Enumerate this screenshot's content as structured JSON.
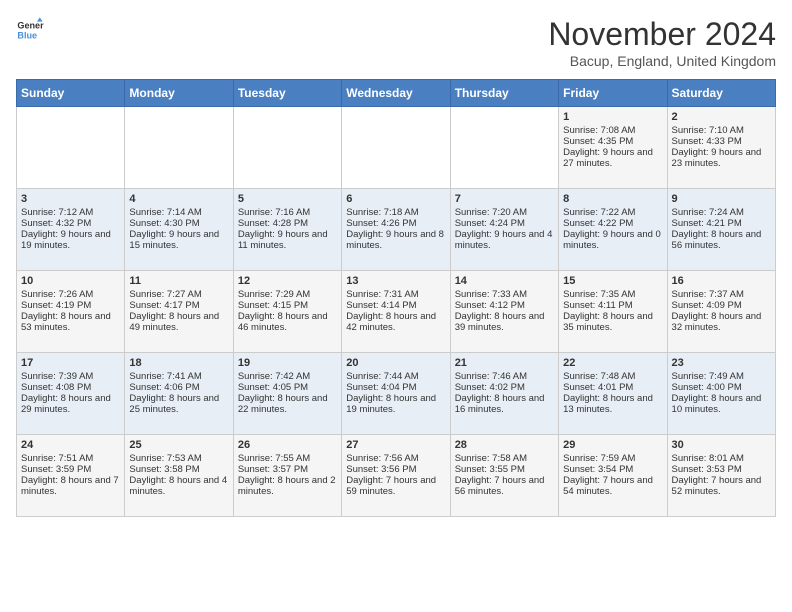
{
  "logo": {
    "line1": "General",
    "line2": "Blue"
  },
  "title": "November 2024",
  "subtitle": "Bacup, England, United Kingdom",
  "days_header": [
    "Sunday",
    "Monday",
    "Tuesday",
    "Wednesday",
    "Thursday",
    "Friday",
    "Saturday"
  ],
  "weeks": [
    [
      {
        "day": "",
        "info": ""
      },
      {
        "day": "",
        "info": ""
      },
      {
        "day": "",
        "info": ""
      },
      {
        "day": "",
        "info": ""
      },
      {
        "day": "",
        "info": ""
      },
      {
        "day": "1",
        "info": "Sunrise: 7:08 AM\nSunset: 4:35 PM\nDaylight: 9 hours and 27 minutes."
      },
      {
        "day": "2",
        "info": "Sunrise: 7:10 AM\nSunset: 4:33 PM\nDaylight: 9 hours and 23 minutes."
      }
    ],
    [
      {
        "day": "3",
        "info": "Sunrise: 7:12 AM\nSunset: 4:32 PM\nDaylight: 9 hours and 19 minutes."
      },
      {
        "day": "4",
        "info": "Sunrise: 7:14 AM\nSunset: 4:30 PM\nDaylight: 9 hours and 15 minutes."
      },
      {
        "day": "5",
        "info": "Sunrise: 7:16 AM\nSunset: 4:28 PM\nDaylight: 9 hours and 11 minutes."
      },
      {
        "day": "6",
        "info": "Sunrise: 7:18 AM\nSunset: 4:26 PM\nDaylight: 9 hours and 8 minutes."
      },
      {
        "day": "7",
        "info": "Sunrise: 7:20 AM\nSunset: 4:24 PM\nDaylight: 9 hours and 4 minutes."
      },
      {
        "day": "8",
        "info": "Sunrise: 7:22 AM\nSunset: 4:22 PM\nDaylight: 9 hours and 0 minutes."
      },
      {
        "day": "9",
        "info": "Sunrise: 7:24 AM\nSunset: 4:21 PM\nDaylight: 8 hours and 56 minutes."
      }
    ],
    [
      {
        "day": "10",
        "info": "Sunrise: 7:26 AM\nSunset: 4:19 PM\nDaylight: 8 hours and 53 minutes."
      },
      {
        "day": "11",
        "info": "Sunrise: 7:27 AM\nSunset: 4:17 PM\nDaylight: 8 hours and 49 minutes."
      },
      {
        "day": "12",
        "info": "Sunrise: 7:29 AM\nSunset: 4:15 PM\nDaylight: 8 hours and 46 minutes."
      },
      {
        "day": "13",
        "info": "Sunrise: 7:31 AM\nSunset: 4:14 PM\nDaylight: 8 hours and 42 minutes."
      },
      {
        "day": "14",
        "info": "Sunrise: 7:33 AM\nSunset: 4:12 PM\nDaylight: 8 hours and 39 minutes."
      },
      {
        "day": "15",
        "info": "Sunrise: 7:35 AM\nSunset: 4:11 PM\nDaylight: 8 hours and 35 minutes."
      },
      {
        "day": "16",
        "info": "Sunrise: 7:37 AM\nSunset: 4:09 PM\nDaylight: 8 hours and 32 minutes."
      }
    ],
    [
      {
        "day": "17",
        "info": "Sunrise: 7:39 AM\nSunset: 4:08 PM\nDaylight: 8 hours and 29 minutes."
      },
      {
        "day": "18",
        "info": "Sunrise: 7:41 AM\nSunset: 4:06 PM\nDaylight: 8 hours and 25 minutes."
      },
      {
        "day": "19",
        "info": "Sunrise: 7:42 AM\nSunset: 4:05 PM\nDaylight: 8 hours and 22 minutes."
      },
      {
        "day": "20",
        "info": "Sunrise: 7:44 AM\nSunset: 4:04 PM\nDaylight: 8 hours and 19 minutes."
      },
      {
        "day": "21",
        "info": "Sunrise: 7:46 AM\nSunset: 4:02 PM\nDaylight: 8 hours and 16 minutes."
      },
      {
        "day": "22",
        "info": "Sunrise: 7:48 AM\nSunset: 4:01 PM\nDaylight: 8 hours and 13 minutes."
      },
      {
        "day": "23",
        "info": "Sunrise: 7:49 AM\nSunset: 4:00 PM\nDaylight: 8 hours and 10 minutes."
      }
    ],
    [
      {
        "day": "24",
        "info": "Sunrise: 7:51 AM\nSunset: 3:59 PM\nDaylight: 8 hours and 7 minutes."
      },
      {
        "day": "25",
        "info": "Sunrise: 7:53 AM\nSunset: 3:58 PM\nDaylight: 8 hours and 4 minutes."
      },
      {
        "day": "26",
        "info": "Sunrise: 7:55 AM\nSunset: 3:57 PM\nDaylight: 8 hours and 2 minutes."
      },
      {
        "day": "27",
        "info": "Sunrise: 7:56 AM\nSunset: 3:56 PM\nDaylight: 7 hours and 59 minutes."
      },
      {
        "day": "28",
        "info": "Sunrise: 7:58 AM\nSunset: 3:55 PM\nDaylight: 7 hours and 56 minutes."
      },
      {
        "day": "29",
        "info": "Sunrise: 7:59 AM\nSunset: 3:54 PM\nDaylight: 7 hours and 54 minutes."
      },
      {
        "day": "30",
        "info": "Sunrise: 8:01 AM\nSunset: 3:53 PM\nDaylight: 7 hours and 52 minutes."
      }
    ]
  ]
}
